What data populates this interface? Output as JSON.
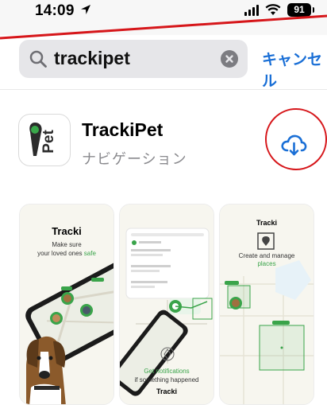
{
  "status_bar": {
    "time": "14:09",
    "location_icon": "location-arrow-icon",
    "signal_icon": "cellular-signal-icon",
    "wifi_icon": "wifi-icon",
    "battery_level": "91"
  },
  "search": {
    "query": "trackipet",
    "search_icon": "magnifying-glass-icon",
    "clear_icon": "clear-x-icon",
    "cancel_label": "キャンセル"
  },
  "app": {
    "name": "TrackiPet",
    "category": "ナビゲーション",
    "icon_text": "Pet",
    "download_icon": "cloud-download-icon"
  },
  "screenshots": [
    {
      "brand": "Tracki",
      "tagline_1": "Make sure",
      "tagline_2a": "your loved ones ",
      "tagline_2b": "safe"
    },
    {
      "brand": "Tracki",
      "tagline_1": "Get notifications",
      "tagline_2": "if something happened"
    },
    {
      "brand": "Tracki",
      "tagline_1": "Create and manage",
      "tagline_2": "places"
    }
  ],
  "colors": {
    "accent_blue": "#1a6fd6",
    "annotation_red": "#d6161a",
    "tracki_green": "#3aa44a"
  }
}
